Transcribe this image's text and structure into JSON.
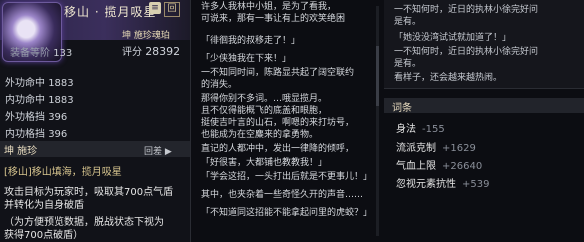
{
  "item": {
    "name": "移山 · 揽月吸星",
    "lock_glyph": "≡",
    "badge": "回",
    "slot_label": "坤 施珍魂珀",
    "level_label": "装备等阶",
    "level_value": "133",
    "score_label": "评分",
    "score_value": "28392",
    "stats": [
      {
        "label": "外功命中",
        "value": "1883"
      },
      {
        "label": "内功命中",
        "value": "1883"
      },
      {
        "label": "外功格挡",
        "value": "396"
      },
      {
        "label": "内功格挡",
        "value": "396"
      }
    ],
    "skill_section": "坤 施珍",
    "detail_button": "回差 ▶",
    "skill_title": "[移山]移山填海，揽月吸星",
    "skill_lines": [
      "攻击目标为玩家时，吸取其700点气盾",
      "并转化为自身破盾",
      "（为方便预览数据，脱战状态下视为",
      "获得700点破盾）"
    ]
  },
  "lore": {
    "lines": [
      "许多人我林中小姐，是为了看我，",
      "可说来，那有一事让有上的欢笑绝困",
      "「徘徊我的叔移走了！」",
      "「少侠独我在下来！」",
      "一不知同时间，陈路显共起了阔空联约",
      "的消失。",
      "那得你别不多词。…哦显揽月。",
      "且不仅得能概飞的底盖和眼胞，",
      "挺使吉叶言的山石，啊嗯的来打坊号，",
      "也能成为在空麋来的拿勇物。",
      "直记的人都冲中，发出一律降的倾呼，",
      "「好很害，大都铺也教教我！」",
      "「学会这招，一头打出后就是不更事儿！」",
      "其中，也夹杂着一些奇怪久开的声音……",
      "「不知道同这招能不能拿起问里的虎蛟？」"
    ]
  },
  "notes": {
    "lines": [
      "一不知何时，近日的执林小徐完好问",
      "是有。",
      "「她没没湾试试就加道了！」",
      "一不知何时，近日的执林小徐完好问",
      "是有。",
      "看样子，还会越来越热闹。"
    ],
    "section": "词条",
    "attrs": [
      {
        "label": "身法",
        "value": "-155"
      },
      {
        "label": "流派克制",
        "value": "+1629"
      },
      {
        "label": "气血上限",
        "value": "+26640"
      },
      {
        "label": "忽视元素抗性",
        "value": "+539"
      }
    ]
  }
}
